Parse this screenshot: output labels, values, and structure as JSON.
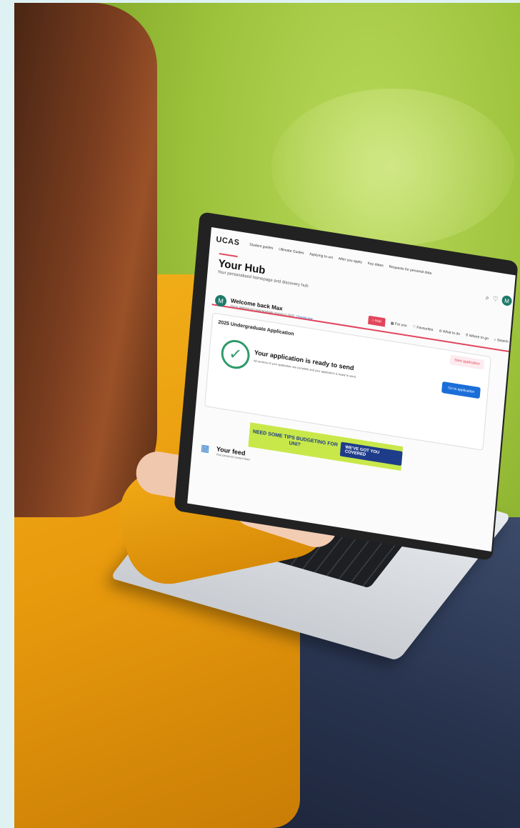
{
  "screen": {
    "logo": "UCAS",
    "nav_links": [
      "Student guides",
      "Ultimate Guides",
      "Applying to uni",
      "After you apply",
      "Key dates",
      "Requests for personal data"
    ],
    "avatar_initial": "M",
    "page_title": "Your Hub",
    "page_subtitle": "Your personalised homepage and discovery hub",
    "tabs": [
      "Hub",
      "For you",
      "Favourites",
      "What to do",
      "Where to go",
      "Search"
    ],
    "welcome_title": "Welcome back Max",
    "welcome_sub": "You're applying for Undergraduate courses in 2025 · ",
    "change_link": "Change year",
    "application_heading": "2025 Undergraduate Application",
    "start_button": "Start application",
    "ready_title": "Your application is ready to send",
    "ready_sub": "All sections of your application are complete and your application is ready to send.",
    "go_button": "Go to application",
    "ad_left": "NEED SOME TIPS BUDGETING FOR UNI?",
    "ad_right": "WE'VE GOT YOU COVERED",
    "feed_title": "Your feed",
    "feed_sub": "Your personal content feed"
  },
  "icons": {
    "search": "search-icon",
    "heart": "heart-icon",
    "check": "check-circle-icon",
    "feed": "grid-icon"
  },
  "colors": {
    "accent": "#e2455c",
    "primary_button": "#1a6ed8",
    "success": "#2e9a6a",
    "avatar": "#1f7a6b"
  }
}
